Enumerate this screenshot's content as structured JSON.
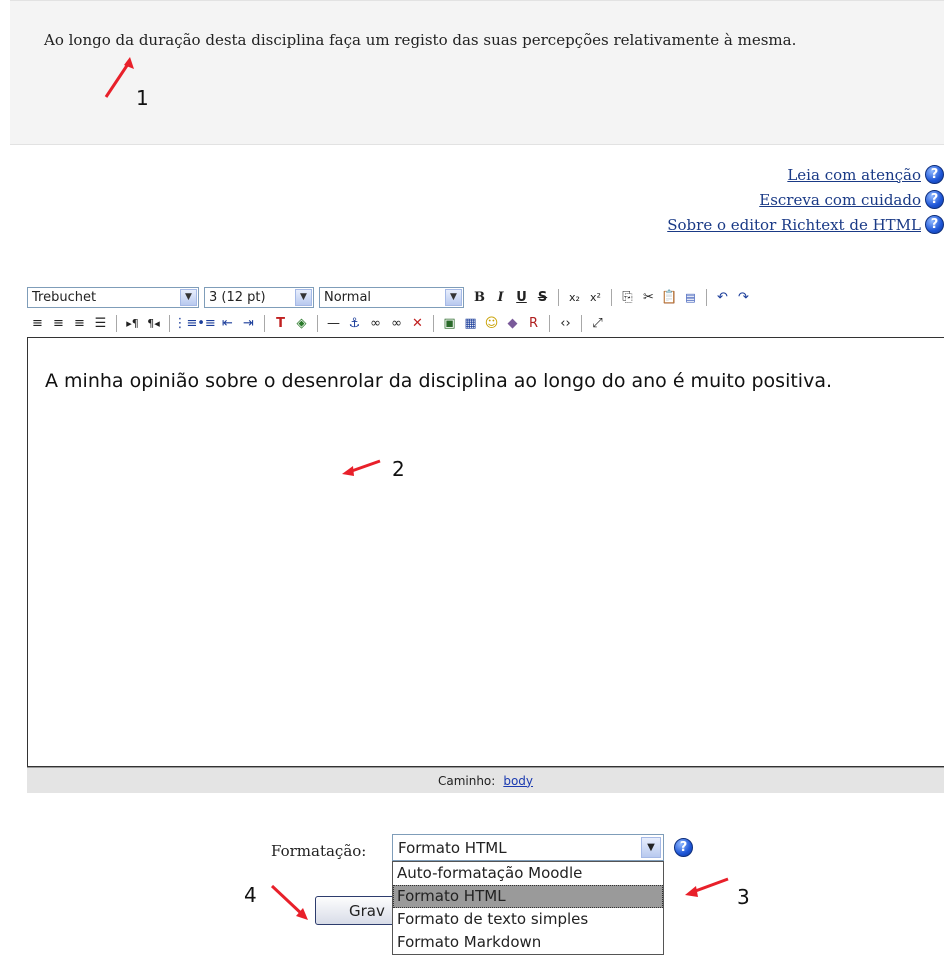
{
  "intro": {
    "text": "Ao longo da duração desta disciplina faça um registo das suas percepções relativamente à mesma."
  },
  "help_links": [
    {
      "label": "Leia com atenção"
    },
    {
      "label": "Escreva com cuidado"
    },
    {
      "label": "Sobre o editor Richtext de HTML"
    }
  ],
  "toolbar": {
    "font": "Trebuchet",
    "size": "3 (12 pt)",
    "style": "Normal"
  },
  "editor": {
    "content": "A minha opinião sobre o desenrolar da disciplina ao longo do ano é muito positiva.",
    "path_label": "Caminho:",
    "path_value": "body"
  },
  "format": {
    "label": "Formatação:",
    "selected": "Formato HTML",
    "options": [
      "Auto-formatação Moodle",
      "Formato HTML",
      "Formato de texto simples",
      "Formato Markdown"
    ]
  },
  "save_button": {
    "label": "Grav"
  },
  "annotations": {
    "n1": "1",
    "n2": "2",
    "n3": "3",
    "n4": "4"
  },
  "colors": {
    "arrow": "#e8202a",
    "link": "#1a3a86"
  }
}
